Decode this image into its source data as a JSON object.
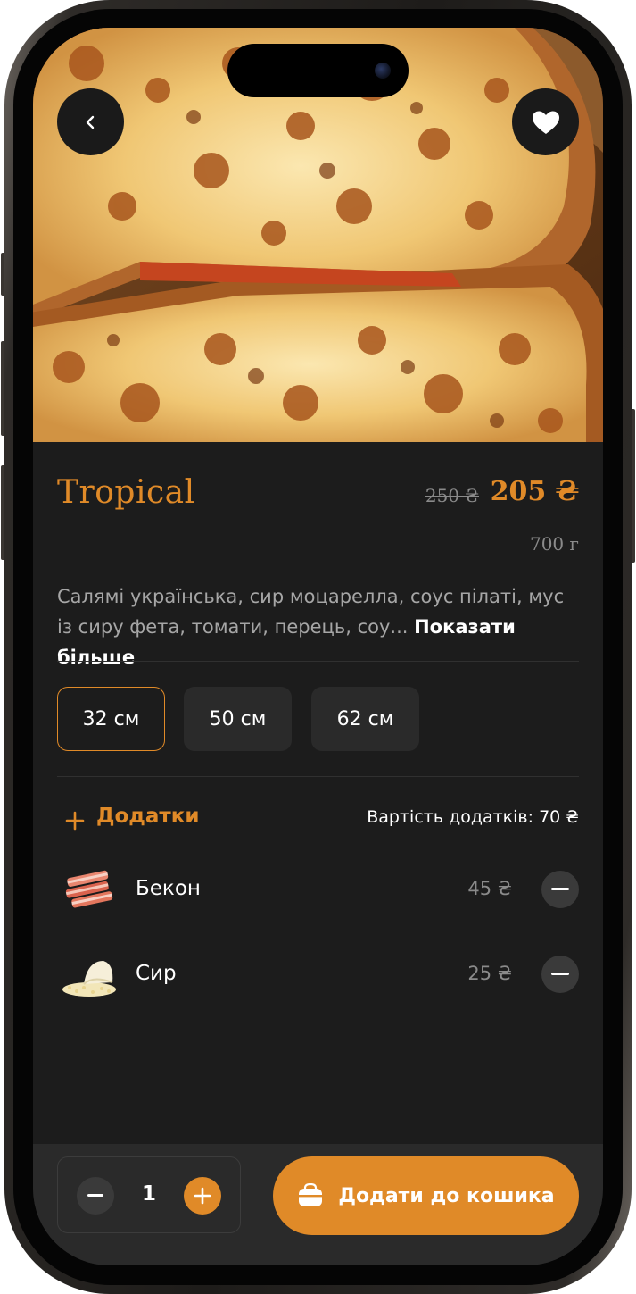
{
  "header": {
    "back_icon": "chevron-left-icon",
    "favorite_icon": "heart-icon"
  },
  "product": {
    "name": "Tropical",
    "old_price": "250 ₴",
    "price": "205 ₴",
    "weight": "700 г",
    "description": "Салямі українська, сир моцарелла, соус пілаті, мус із сиру фета, томати, перець, соу...",
    "show_more": "Показати більше"
  },
  "sizes": [
    {
      "label": "32 см",
      "selected": true
    },
    {
      "label": "50 см",
      "selected": false
    },
    {
      "label": "62 см",
      "selected": false
    }
  ],
  "addons": {
    "title": "Додатки",
    "total_label": "Вартість додатків: 70 ₴",
    "items": [
      {
        "name": "Бекон",
        "price": "45 ₴",
        "icon": "bacon-icon"
      },
      {
        "name": "Сир",
        "price": "25 ₴",
        "icon": "cheese-icon"
      }
    ]
  },
  "cart": {
    "quantity": "1",
    "add_label": "Додати до кошика",
    "icon": "bag-icon"
  },
  "colors": {
    "accent": "#e08a28",
    "background": "#1c1c1c",
    "surface": "#2a2a2a"
  }
}
